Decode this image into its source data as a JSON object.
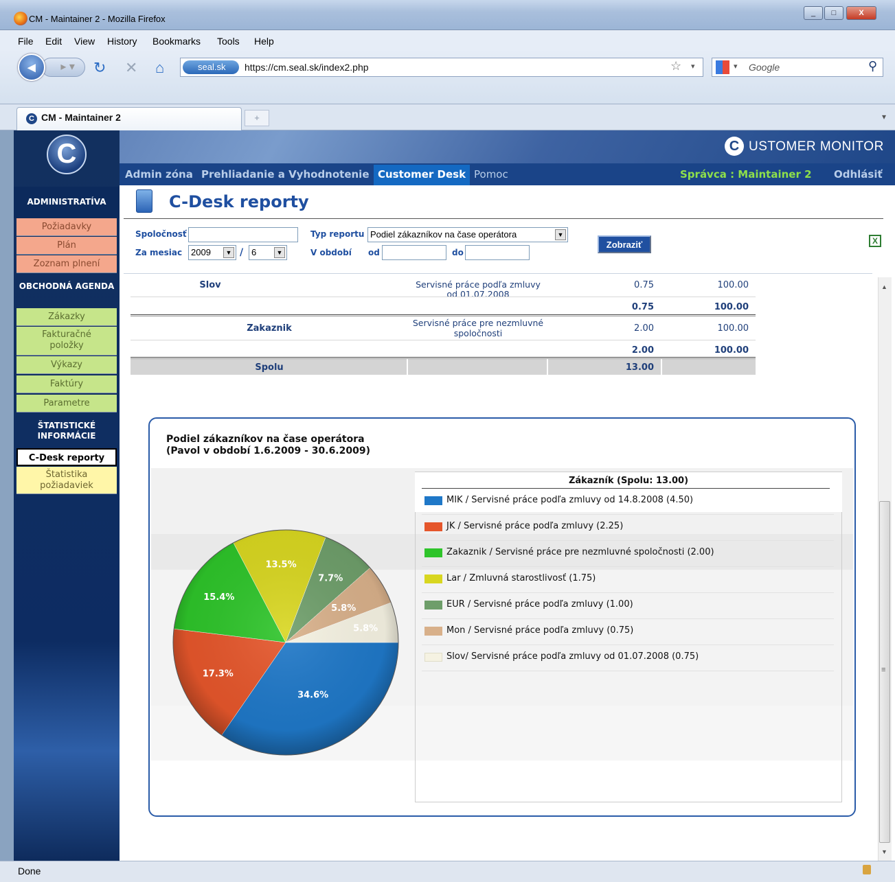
{
  "browser": {
    "window_title": "CM - Maintainer 2 - Mozilla Firefox",
    "menu": [
      "File",
      "Edit",
      "View",
      "History",
      "Bookmarks",
      "Tools",
      "Help"
    ],
    "site_badge": "seal.sk",
    "url": "https://cm.seal.sk/index2.php",
    "search_placeholder": "Google",
    "tab_label": "CM - Maintainer 2",
    "new_tab": "+",
    "status": "Done"
  },
  "app": {
    "brand": "USTOMER MONITOR",
    "brand_c": "C",
    "logo": "C",
    "topnav": {
      "admin": "Admin zóna",
      "browse": "Prehliadanie a Vyhodnotenie",
      "desk": "Customer Desk",
      "help": "Pomoc",
      "user": "Správca : Maintainer 2",
      "logout": "Odhlásiť"
    },
    "sidebar": {
      "sec1": "ADMINISTRATÍVA",
      "sec1_items": [
        "Požiadavky",
        "Plán",
        "Zoznam plnení"
      ],
      "sec2": "OBCHODNÁ AGENDA",
      "sec2_items": [
        "Zákazky",
        "Fakturačné položky",
        "Výkazy",
        "Faktúry",
        "Parametre"
      ],
      "sec3": "ŠTATISTICKÉ INFORMÁCIE",
      "sec3_items": [
        "C-Desk reporty",
        "Štatistika požiadaviek"
      ]
    }
  },
  "page": {
    "title": "C-Desk reporty",
    "form": {
      "company_label": "Spoločnosť",
      "company_value": "",
      "report_type_label": "Typ reportu",
      "report_type_value": "Podiel zákazníkov na čase operátora",
      "month_label": "Za mesiac",
      "year_value": "2009",
      "slash": "/",
      "month_value": "6",
      "period_label": "V období",
      "from_label": "od",
      "from_value": "",
      "to_label": "do",
      "to_value": "",
      "show_button": "Zobraziť"
    },
    "table": {
      "rows": [
        {
          "customer": "Slov",
          "service": "Servisné práce podľa zmluvy od 01.07.2008",
          "hours": "0.75",
          "percent": "100.00"
        },
        {
          "customer": "",
          "service": "",
          "hours": "0.75",
          "percent": "100.00",
          "subtotal": true
        },
        {
          "customer": "Zakaznik",
          "service": "Servisné práce pre nezmluvné spoločnosti",
          "hours": "2.00",
          "percent": "100.00"
        },
        {
          "customer": "",
          "service": "",
          "hours": "2.00",
          "percent": "100.00",
          "subtotal": true
        }
      ],
      "total_label": "Spolu",
      "total_hours": "13.00"
    }
  },
  "chart_data": {
    "type": "pie",
    "title": "Podiel zákazníkov na čase operátora",
    "subtitle": "(Pavol  v období 1.6.2009 - 30.6.2009)",
    "legend_title": "Zákazník (Spolu: 13.00)",
    "slices": [
      {
        "label": "MIK / Servisné práce podľa zmluvy od 14.8.2008 (4.50)",
        "value": 4.5,
        "percent_label": "34.6%",
        "color": "#1f78c8"
      },
      {
        "label": "JK  / Servisné práce podľa zmluvy (2.25)",
        "value": 2.25,
        "percent_label": "17.3%",
        "color": "#e5562b"
      },
      {
        "label": "Zakaznik / Servisné práce pre nezmluvné spoločnosti (2.00)",
        "value": 2.0,
        "percent_label": "15.4%",
        "color": "#2ec42a"
      },
      {
        "label": "Lar / Zmluvná starostlivosť (1.75)",
        "value": 1.75,
        "percent_label": "13.5%",
        "color": "#d8d620"
      },
      {
        "label": "EUR / Servisné práce podľa zmluvy (1.00)",
        "value": 1.0,
        "percent_label": "7.7%",
        "color": "#6e9e6a"
      },
      {
        "label": "Mon / Servisné práce podľa zmluvy (0.75)",
        "value": 0.75,
        "percent_label": "5.8%",
        "color": "#d8b08a"
      },
      {
        "label": "Slov/ Servisné práce podľa zmluvy od 01.07.2008 (0.75)",
        "value": 0.75,
        "percent_label": "5.8%",
        "color": "#f5f2e2"
      }
    ]
  }
}
